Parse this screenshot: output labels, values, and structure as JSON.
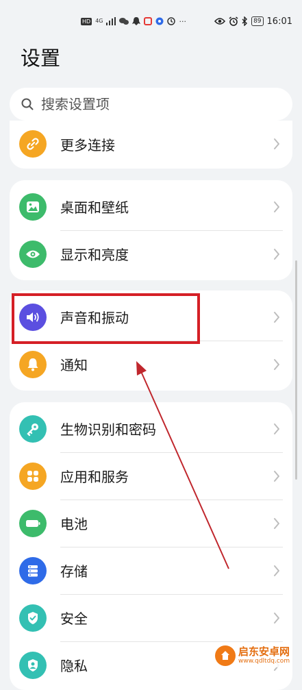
{
  "status_bar": {
    "hd": "HD",
    "network": "4G",
    "more": "···",
    "battery": "89",
    "time": "16:01"
  },
  "page_title": "设置",
  "search": {
    "placeholder": "搜索设置项"
  },
  "groups": [
    {
      "items": [
        {
          "label": "更多连接",
          "icon": "link-icon",
          "color": "#f5a623"
        }
      ]
    },
    {
      "items": [
        {
          "label": "桌面和壁纸",
          "icon": "wallpaper-icon",
          "color": "#3dbb6b"
        },
        {
          "label": "显示和亮度",
          "icon": "eye-icon",
          "color": "#3dbb6b"
        }
      ]
    },
    {
      "items": [
        {
          "label": "声音和振动",
          "icon": "speaker-icon",
          "color": "#5b4fe0"
        },
        {
          "label": "通知",
          "icon": "bell-icon",
          "color": "#f5a623"
        }
      ]
    },
    {
      "items": [
        {
          "label": "生物识别和密码",
          "icon": "key-icon",
          "color": "#33c0b3"
        },
        {
          "label": "应用和服务",
          "icon": "apps-grid-icon",
          "color": "#f5a623"
        },
        {
          "label": "电池",
          "icon": "battery-icon",
          "color": "#3dbb6b"
        },
        {
          "label": "存储",
          "icon": "storage-icon",
          "color": "#2f6be8"
        },
        {
          "label": "安全",
          "icon": "shield-icon",
          "color": "#33c0b3"
        },
        {
          "label": "隐私",
          "icon": "privacy-icon",
          "color": "#33c0b3"
        }
      ]
    }
  ],
  "watermark": {
    "name": "启东安卓网",
    "url": "www.qdltdq.com"
  },
  "colors": {
    "highlight": "#d51f26",
    "arrow": "#c0272d"
  }
}
